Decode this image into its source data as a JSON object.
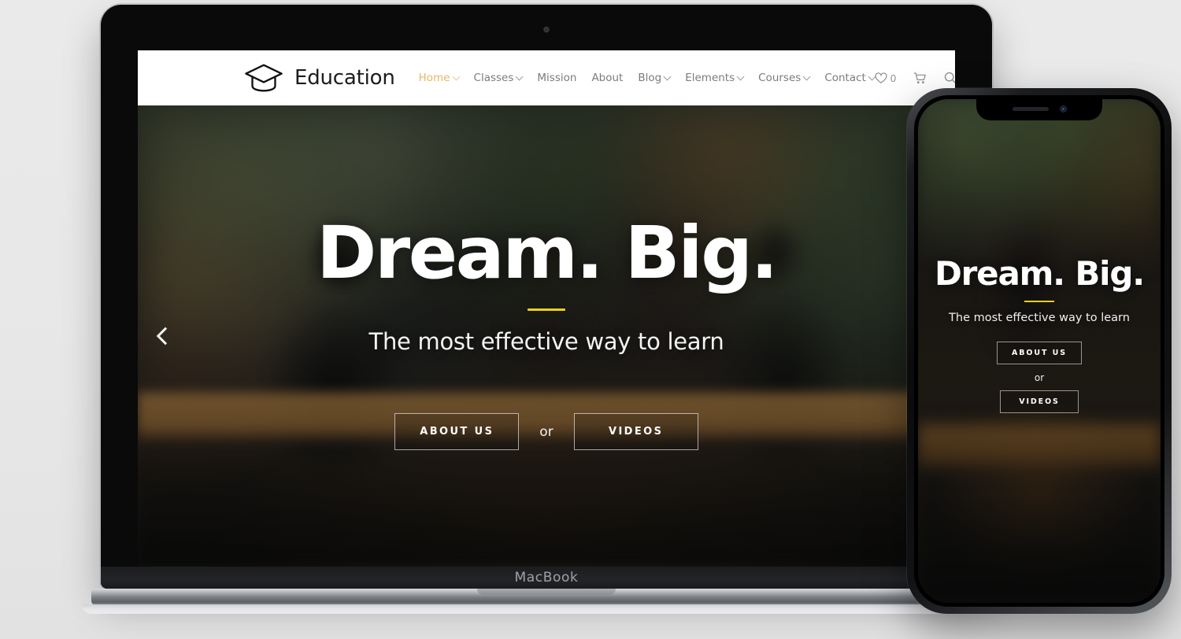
{
  "background_color": "#e9e9e9",
  "accent_color": "#e3b962",
  "divider_color": "#e8d020",
  "devices": {
    "laptop": {
      "brand_label": "MacBook"
    },
    "phone": {
      "notch": "iphone-x-notch"
    }
  },
  "site": {
    "header": {
      "logo": {
        "icon": "graduation-cap-icon",
        "text": "Education"
      },
      "nav": [
        {
          "label": "Home",
          "has_dropdown": true,
          "active": true
        },
        {
          "label": "Classes",
          "has_dropdown": true,
          "active": false
        },
        {
          "label": "Mission",
          "has_dropdown": false,
          "active": false
        },
        {
          "label": "About",
          "has_dropdown": false,
          "active": false
        },
        {
          "label": "Blog",
          "has_dropdown": true,
          "active": false
        },
        {
          "label": "Elements",
          "has_dropdown": true,
          "active": false
        },
        {
          "label": "Courses",
          "has_dropdown": true,
          "active": false
        },
        {
          "label": "Contact",
          "has_dropdown": true,
          "active": false
        }
      ],
      "tools": {
        "wishlist_icon": "heart-icon",
        "wishlist_count": "0",
        "cart_icon": "cart-icon",
        "search_icon": "search-icon",
        "menu_icon": "hamburger-menu-icon"
      }
    },
    "hero": {
      "title": "Dream. Big.",
      "subtitle": "The most effective way to learn",
      "primary_button": "ABOUT US",
      "separator": "or",
      "secondary_button": "VIDEOS",
      "prev_arrow_icon": "chevron-left-icon"
    }
  },
  "phone_site": {
    "hero": {
      "title": "Dream. Big.",
      "subtitle": "The most effective way to learn",
      "primary_button": "ABOUT US",
      "separator": "or",
      "secondary_button": "VIDEOS"
    }
  }
}
